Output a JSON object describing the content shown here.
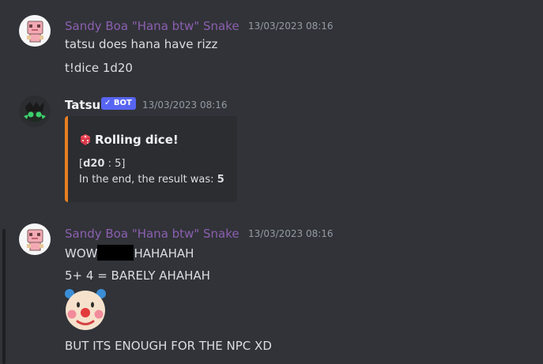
{
  "messages": [
    {
      "author": "Sandy Boa \"Hana btw\" Snake",
      "timestamp": "13/03/2023 08:16",
      "lines": [
        "tatsu does hana have rizz",
        "t!dice 1d20"
      ]
    },
    {
      "author": "Tatsu",
      "badge": "✓ BOT",
      "timestamp": "13/03/2023 08:16",
      "embed": {
        "title": "Rolling dice!",
        "roll_open": "[",
        "roll_die": "d20",
        "roll_rest": " : 5]",
        "result_prefix": "In the end, the result was: ",
        "result_value": "5",
        "accent": "#e67e22"
      }
    },
    {
      "author": "Sandy Boa \"Hana btw\" Snake",
      "timestamp": "13/03/2023 08:16",
      "line1_start": "WOW",
      "line1_end": "HAHAHAH",
      "line2": "5+ 4 = BARELY AHAHAH",
      "emoji": "clown-face-emoji",
      "line3": "BUT ITS ENOUGH FOR THE NPC XD"
    }
  ],
  "colors": {
    "background": "#313338",
    "embed_background": "#2b2d31",
    "bot_badge": "#5865f2",
    "username_sandy": "#8c5fb0"
  }
}
